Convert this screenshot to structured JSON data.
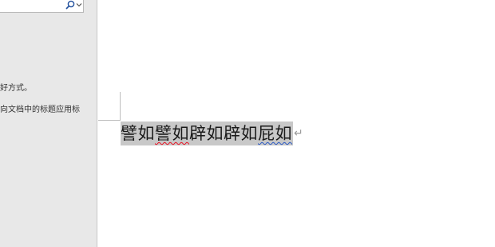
{
  "nav_pane": {
    "search_input": {
      "value": "",
      "placeholder": ""
    },
    "search_icon": "search-icon",
    "dropdown_icon": "chevron-down-icon",
    "text_line_1": "好方式。",
    "text_line_2": "向文档中的标题应用标"
  },
  "document": {
    "segment_1": "譬如",
    "segment_2": "譬如",
    "segment_3": "辟如",
    "segment_4": "辟如",
    "segment_5": "屁如",
    "paragraph_mark": "↵"
  },
  "colors": {
    "nav_background": "#e8e8e8",
    "selection_highlight": "#c8c8c8",
    "spelling_underline": "#e81123",
    "grammar_underline": "#2b59c3"
  }
}
